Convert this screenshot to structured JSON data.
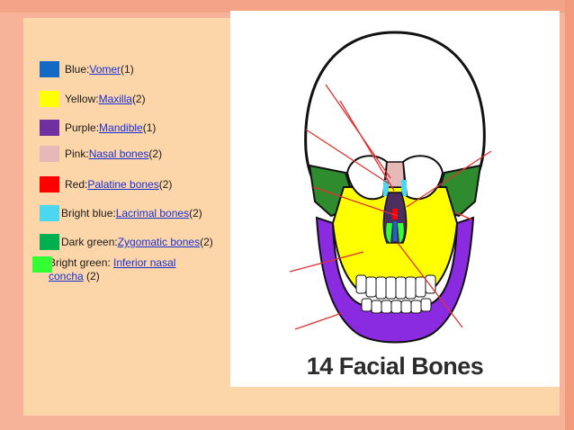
{
  "legend": [
    {
      "prefix": "Blue: ",
      "link": "Vomer",
      "suffix": " (1)",
      "color": "#1469c7"
    },
    {
      "prefix": "Yellow: ",
      "link": "Maxilla",
      "suffix": " (2)",
      "color": "#ffff00"
    },
    {
      "prefix": "Purple: ",
      "link": "Mandible",
      "suffix": " (1)",
      "color": "#7030a0"
    },
    {
      "prefix": "Pink: ",
      "link": "Nasal bones",
      "suffix": " (2)",
      "color": "#e6b8b7"
    },
    {
      "prefix": "Red: ",
      "link": "Palatine bones",
      "suffix": " (2)",
      "color": "#ff0000"
    },
    {
      "prefix": "Bright blue: ",
      "link": "Lacrimal bones",
      "suffix": " (2)",
      "color": "#4cd7f0"
    },
    {
      "prefix": "Dark green: ",
      "link": "Zygomatic bones",
      "suffix": " (2)",
      "color": "#00b050"
    },
    {
      "prefix": "Bright green: ",
      "link": "Inferior nasal concha",
      "suffix": " (2)",
      "color": "#33ff33"
    }
  ],
  "figure": {
    "title": "14 Facial Bones"
  },
  "colors": {
    "slide_background": "#fcd6a8",
    "frame": "#f6b39a",
    "link": "#1a2fd6",
    "skull_bone": "#ffffff",
    "zygomatic": "#2e8b2e",
    "maxilla": "#ffff00",
    "mandible": "#8a2be2",
    "leader_lines": "#e03030"
  }
}
